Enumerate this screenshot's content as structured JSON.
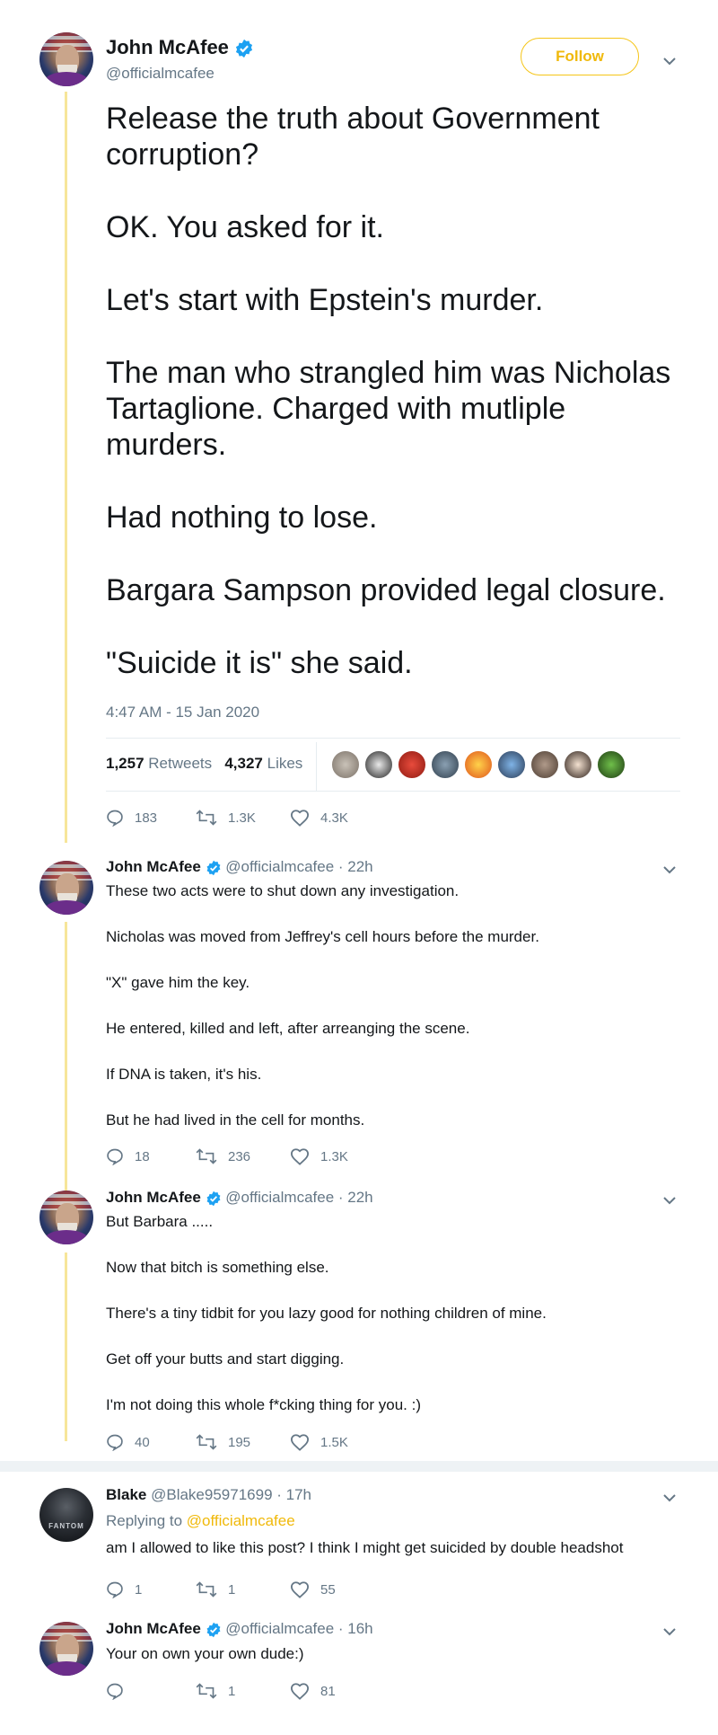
{
  "colors": {
    "accent": "#f0b90b",
    "verified": "#1da1f2",
    "muted": "#657786",
    "thread": "#f7e69a"
  },
  "main_tweet": {
    "author_name": "John McAfee",
    "handle": "@officialmcafee",
    "follow_label": "Follow",
    "paragraphs": [
      "Release the truth about Government corruption?",
      "OK. You asked for it.",
      "Let's start with Epstein's murder.",
      "The man who strangled him was Nicholas Tartaglione. Charged with mutliple murders.",
      "Had nothing to lose.",
      "Bargara Sampson provided legal closure.",
      "\"Suicide it is\" she said."
    ],
    "timestamp": "4:47 AM - 15 Jan 2020",
    "retweets_count": "1,257",
    "retweets_label": "Retweets",
    "likes_count": "4,327",
    "likes_label": "Likes",
    "actions": {
      "replies": "183",
      "retweets": "1.3K",
      "likes": "4.3K"
    }
  },
  "replies": [
    {
      "author_name": "John McAfee",
      "handle": "@officialmcafee",
      "time": "· 22h",
      "paragraphs": [
        "These two acts were to shut down any investigation.",
        "Nicholas was moved from Jeffrey's cell hours before the murder.",
        "\"X\" gave him the key.",
        "He entered, killed and left, after arreanging the scene.",
        "If DNA is taken, it's his.",
        "But he had lived in the cell for months."
      ],
      "actions": {
        "replies": "18",
        "retweets": "236",
        "likes": "1.3K"
      }
    },
    {
      "author_name": "John McAfee",
      "handle": "@officialmcafee",
      "time": "· 22h",
      "paragraphs": [
        "But Barbara .....",
        "Now that bitch is something else.",
        "There's a tiny tidbit for you lazy good for nothing children of mine.",
        "Get off your butts and start digging.",
        "I'm not doing this whole f*cking thing for you. :)"
      ],
      "actions": {
        "replies": "40",
        "retweets": "195",
        "likes": "1.5K"
      }
    },
    {
      "author_name": "Blake",
      "handle": "@Blake95971699",
      "time": "· 17h",
      "avatar_text": "FANTOM",
      "replying_prefix": "Replying to",
      "replying_to": "@officialmcafee",
      "text": "am I allowed to like this post? I think I might get suicided by double headshot",
      "actions": {
        "replies": "1",
        "retweets": "1",
        "likes": "55"
      }
    },
    {
      "author_name": "John McAfee",
      "handle": "@officialmcafee",
      "time": "· 16h",
      "text": "Your on own your own dude:)",
      "actions": {
        "replies": "",
        "retweets": "1",
        "likes": "81"
      }
    }
  ]
}
